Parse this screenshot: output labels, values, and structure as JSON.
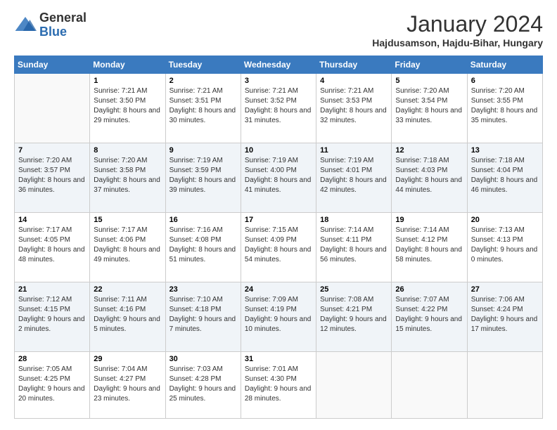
{
  "header": {
    "logo": {
      "general": "General",
      "blue": "Blue"
    },
    "title": "January 2024",
    "location": "Hajdusamson, Hajdu-Bihar, Hungary"
  },
  "weekdays": [
    "Sunday",
    "Monday",
    "Tuesday",
    "Wednesday",
    "Thursday",
    "Friday",
    "Saturday"
  ],
  "weeks": [
    [
      {
        "day": "",
        "sunrise": "",
        "sunset": "",
        "daylight": ""
      },
      {
        "day": "1",
        "sunrise": "Sunrise: 7:21 AM",
        "sunset": "Sunset: 3:50 PM",
        "daylight": "Daylight: 8 hours and 29 minutes."
      },
      {
        "day": "2",
        "sunrise": "Sunrise: 7:21 AM",
        "sunset": "Sunset: 3:51 PM",
        "daylight": "Daylight: 8 hours and 30 minutes."
      },
      {
        "day": "3",
        "sunrise": "Sunrise: 7:21 AM",
        "sunset": "Sunset: 3:52 PM",
        "daylight": "Daylight: 8 hours and 31 minutes."
      },
      {
        "day": "4",
        "sunrise": "Sunrise: 7:21 AM",
        "sunset": "Sunset: 3:53 PM",
        "daylight": "Daylight: 8 hours and 32 minutes."
      },
      {
        "day": "5",
        "sunrise": "Sunrise: 7:20 AM",
        "sunset": "Sunset: 3:54 PM",
        "daylight": "Daylight: 8 hours and 33 minutes."
      },
      {
        "day": "6",
        "sunrise": "Sunrise: 7:20 AM",
        "sunset": "Sunset: 3:55 PM",
        "daylight": "Daylight: 8 hours and 35 minutes."
      }
    ],
    [
      {
        "day": "7",
        "sunrise": "Sunrise: 7:20 AM",
        "sunset": "Sunset: 3:57 PM",
        "daylight": "Daylight: 8 hours and 36 minutes."
      },
      {
        "day": "8",
        "sunrise": "Sunrise: 7:20 AM",
        "sunset": "Sunset: 3:58 PM",
        "daylight": "Daylight: 8 hours and 37 minutes."
      },
      {
        "day": "9",
        "sunrise": "Sunrise: 7:19 AM",
        "sunset": "Sunset: 3:59 PM",
        "daylight": "Daylight: 8 hours and 39 minutes."
      },
      {
        "day": "10",
        "sunrise": "Sunrise: 7:19 AM",
        "sunset": "Sunset: 4:00 PM",
        "daylight": "Daylight: 8 hours and 41 minutes."
      },
      {
        "day": "11",
        "sunrise": "Sunrise: 7:19 AM",
        "sunset": "Sunset: 4:01 PM",
        "daylight": "Daylight: 8 hours and 42 minutes."
      },
      {
        "day": "12",
        "sunrise": "Sunrise: 7:18 AM",
        "sunset": "Sunset: 4:03 PM",
        "daylight": "Daylight: 8 hours and 44 minutes."
      },
      {
        "day": "13",
        "sunrise": "Sunrise: 7:18 AM",
        "sunset": "Sunset: 4:04 PM",
        "daylight": "Daylight: 8 hours and 46 minutes."
      }
    ],
    [
      {
        "day": "14",
        "sunrise": "Sunrise: 7:17 AM",
        "sunset": "Sunset: 4:05 PM",
        "daylight": "Daylight: 8 hours and 48 minutes."
      },
      {
        "day": "15",
        "sunrise": "Sunrise: 7:17 AM",
        "sunset": "Sunset: 4:06 PM",
        "daylight": "Daylight: 8 hours and 49 minutes."
      },
      {
        "day": "16",
        "sunrise": "Sunrise: 7:16 AM",
        "sunset": "Sunset: 4:08 PM",
        "daylight": "Daylight: 8 hours and 51 minutes."
      },
      {
        "day": "17",
        "sunrise": "Sunrise: 7:15 AM",
        "sunset": "Sunset: 4:09 PM",
        "daylight": "Daylight: 8 hours and 54 minutes."
      },
      {
        "day": "18",
        "sunrise": "Sunrise: 7:14 AM",
        "sunset": "Sunset: 4:11 PM",
        "daylight": "Daylight: 8 hours and 56 minutes."
      },
      {
        "day": "19",
        "sunrise": "Sunrise: 7:14 AM",
        "sunset": "Sunset: 4:12 PM",
        "daylight": "Daylight: 8 hours and 58 minutes."
      },
      {
        "day": "20",
        "sunrise": "Sunrise: 7:13 AM",
        "sunset": "Sunset: 4:13 PM",
        "daylight": "Daylight: 9 hours and 0 minutes."
      }
    ],
    [
      {
        "day": "21",
        "sunrise": "Sunrise: 7:12 AM",
        "sunset": "Sunset: 4:15 PM",
        "daylight": "Daylight: 9 hours and 2 minutes."
      },
      {
        "day": "22",
        "sunrise": "Sunrise: 7:11 AM",
        "sunset": "Sunset: 4:16 PM",
        "daylight": "Daylight: 9 hours and 5 minutes."
      },
      {
        "day": "23",
        "sunrise": "Sunrise: 7:10 AM",
        "sunset": "Sunset: 4:18 PM",
        "daylight": "Daylight: 9 hours and 7 minutes."
      },
      {
        "day": "24",
        "sunrise": "Sunrise: 7:09 AM",
        "sunset": "Sunset: 4:19 PM",
        "daylight": "Daylight: 9 hours and 10 minutes."
      },
      {
        "day": "25",
        "sunrise": "Sunrise: 7:08 AM",
        "sunset": "Sunset: 4:21 PM",
        "daylight": "Daylight: 9 hours and 12 minutes."
      },
      {
        "day": "26",
        "sunrise": "Sunrise: 7:07 AM",
        "sunset": "Sunset: 4:22 PM",
        "daylight": "Daylight: 9 hours and 15 minutes."
      },
      {
        "day": "27",
        "sunrise": "Sunrise: 7:06 AM",
        "sunset": "Sunset: 4:24 PM",
        "daylight": "Daylight: 9 hours and 17 minutes."
      }
    ],
    [
      {
        "day": "28",
        "sunrise": "Sunrise: 7:05 AM",
        "sunset": "Sunset: 4:25 PM",
        "daylight": "Daylight: 9 hours and 20 minutes."
      },
      {
        "day": "29",
        "sunrise": "Sunrise: 7:04 AM",
        "sunset": "Sunset: 4:27 PM",
        "daylight": "Daylight: 9 hours and 23 minutes."
      },
      {
        "day": "30",
        "sunrise": "Sunrise: 7:03 AM",
        "sunset": "Sunset: 4:28 PM",
        "daylight": "Daylight: 9 hours and 25 minutes."
      },
      {
        "day": "31",
        "sunrise": "Sunrise: 7:01 AM",
        "sunset": "Sunset: 4:30 PM",
        "daylight": "Daylight: 9 hours and 28 minutes."
      },
      {
        "day": "",
        "sunrise": "",
        "sunset": "",
        "daylight": ""
      },
      {
        "day": "",
        "sunrise": "",
        "sunset": "",
        "daylight": ""
      },
      {
        "day": "",
        "sunrise": "",
        "sunset": "",
        "daylight": ""
      }
    ]
  ]
}
